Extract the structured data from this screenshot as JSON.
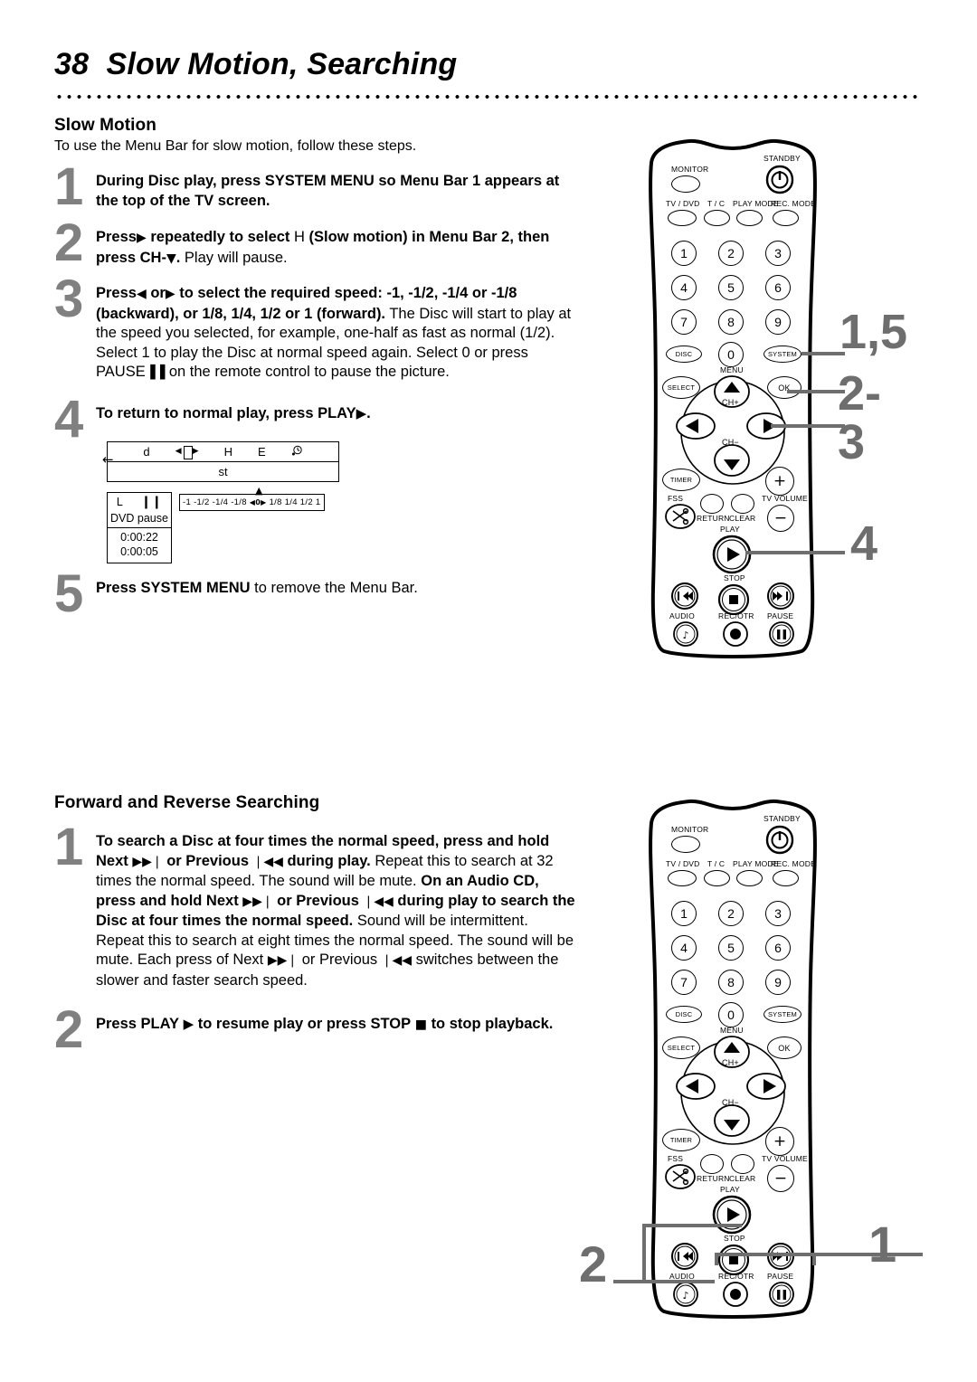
{
  "page": {
    "number": "38",
    "title": "Slow Motion, Searching"
  },
  "sections": [
    {
      "heading": "Slow Motion",
      "intro": "To use the Menu Bar for slow motion, follow these steps."
    },
    {
      "heading": "Forward and Reverse Searching"
    }
  ],
  "slow_motion_steps": [
    {
      "num": "1",
      "bold_1": "During Disc play, press SYSTEM MENU so Menu Bar 1 appears at the top of the TV screen."
    },
    {
      "num": "2",
      "bold_1": "Press",
      "sym_1": "▶",
      "bold_2": "repeatedly to select",
      "glyph": "H",
      "bold_3": "(Slow motion) in Menu Bar 2, then press CH-",
      "sym_2": "▼",
      "bold_4": ".",
      "plain_1": "Play will pause."
    },
    {
      "num": "3",
      "bold_1": "Press",
      "sym_1": "◀",
      "bold_2": "or",
      "sym_2": "▶",
      "bold_3": "to select the required speed: -1, -1/2, -1/4 or -1/8 (backward), or 1/8, 1/4, 1/2 or 1 (forward).",
      "plain_1": "The Disc will start to play at the speed you selected, for example, one-half as fast as normal (1/2).",
      "plain_2": "Select 1 to play the Disc at normal speed again. Select 0 or press PAUSE",
      "sym_3": "▐▐",
      "plain_3": "on the remote control to pause the picture."
    },
    {
      "num": "4",
      "bold_1": "To return to normal play, press PLAY",
      "sym_1": "▶",
      "bold_2": "."
    },
    {
      "num": "5",
      "bold_1": "Press SYSTEM MENU",
      "plain_1": "to remove the Menu Bar."
    }
  ],
  "searching_steps": [
    {
      "num": "1",
      "bold_1": "To search a Disc at four times the normal speed, press and hold Next",
      "sym_1": "▶▶❘",
      "bold_2": "or Previous",
      "sym_2": "❘◀◀",
      "bold_3": "during play.",
      "plain_1": "Repeat this to search at 32 times the normal speed. The sound will be mute.",
      "bold_4": "On an Audio CD, press and hold Next",
      "sym_3": "▶▶❘",
      "bold_5": "or Previous",
      "sym_4": "❘◀◀",
      "bold_6": "during play to search the Disc at four times the normal speed.",
      "plain_2": "Sound will be intermittent. Repeat this to search at eight times the normal speed. The sound will be mute.",
      "plain_3": "Each press of Next",
      "sym_5": "▶▶❘",
      "plain_4": "or Previous",
      "sym_6": "❘◀◀",
      "plain_5": "switches between the slower and faster search speed."
    },
    {
      "num": "2",
      "bold_1": "Press PLAY",
      "sym_1": "▶",
      "bold_2": "to resume play or press STOP",
      "sym_2": "■",
      "bold_3": "to stop playback."
    }
  ],
  "osd": {
    "menu_bar_icons": [
      "d",
      "slow-motion-icon",
      "H",
      "E",
      "clock-icon"
    ],
    "menu_bar_row1": {
      "item1": "d",
      "item3": "H",
      "item4": "E"
    },
    "menu_bar_row2": "st",
    "left_arrow": "←",
    "status": {
      "left": "L",
      "pause_icon": "❙❙",
      "mode": "DVD pause",
      "time_total": "0:00:22",
      "time_elapsed": "0:00:05"
    },
    "speed_scale": [
      "-1",
      "-1/2",
      "-1/4",
      "-1/8",
      "◀0▶",
      "1/8",
      "1/4",
      "1/2",
      "1"
    ],
    "speed_marker": "▲"
  },
  "remote": {
    "labels": {
      "monitor": "MONITOR",
      "standby": "STANDBY",
      "tv_dvd": "TV / DVD",
      "tc": "T / C",
      "play_mode": "PLAY MODE",
      "rec_mode": "REC. MODE",
      "menu": "MENU",
      "select": "SELECT",
      "ok": "OK",
      "ch_plus": "CH+",
      "ch_minus": "CH−",
      "timer": "TIMER",
      "fss": "FSS",
      "return": "RETURN",
      "clear": "CLEAR",
      "tv_volume": "TV VOLUME",
      "play": "PLAY",
      "stop": "STOP",
      "audio": "AUDIO",
      "rec_otr": "REC/OTR",
      "pause": "PAUSE",
      "disc": "DISC",
      "system": "SYSTEM"
    },
    "numpad": [
      "1",
      "2",
      "3",
      "4",
      "5",
      "6",
      "7",
      "8",
      "9",
      "0"
    ],
    "glyphs": {
      "standby_power": "⏻",
      "up": "▲",
      "down": "▼",
      "left": "◀",
      "right": "▶",
      "plus": "+",
      "minus": "−",
      "play": "▶",
      "stop": "■",
      "pause": "❙❙",
      "record": "●",
      "prev": "❘◀◀",
      "next": "▶▶❘",
      "scissors": "✂"
    }
  },
  "callouts": {
    "top_remote": [
      "1,5",
      "2-3",
      "4"
    ],
    "bottom_remote": [
      "1",
      "2"
    ]
  },
  "colors": {
    "callout_gray": "#6e6e6e",
    "step_number_gray": "#808080",
    "ink": "#000000",
    "background": "#ffffff"
  }
}
